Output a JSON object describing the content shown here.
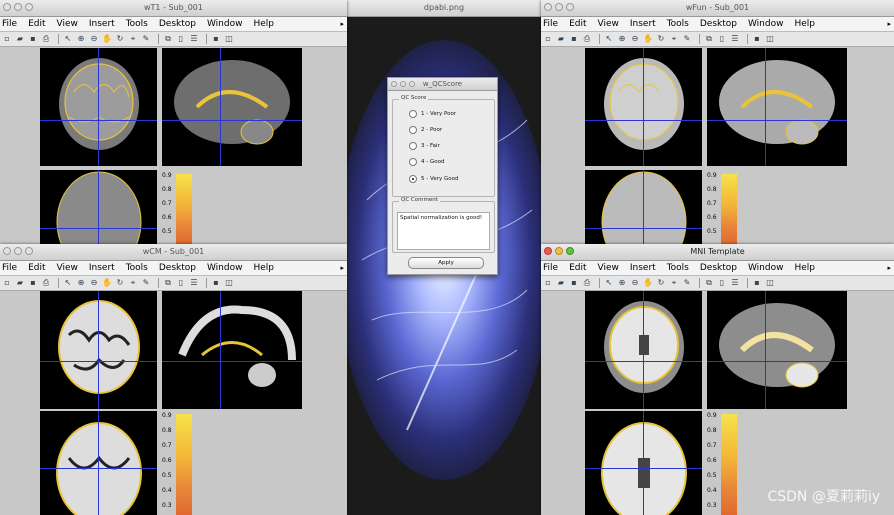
{
  "menu": [
    "File",
    "Edit",
    "View",
    "Insert",
    "Tools",
    "Desktop",
    "Window",
    "Help"
  ],
  "windows": {
    "wt1": {
      "title": "wT1 - Sub_001"
    },
    "wcm": {
      "title": "wCM - Sub_001"
    },
    "wfun": {
      "title": "wFun - Sub_001"
    },
    "mni": {
      "title": "MNI Template"
    }
  },
  "center_image": {
    "title": "dpabi.png"
  },
  "colorbar_ticks": [
    "0.9",
    "0.8",
    "0.7",
    "0.6",
    "0.5",
    "0.4",
    "0.3"
  ],
  "dialog": {
    "title": "w_QCScore",
    "score_group": "QC Score",
    "options": [
      "1 - Very Poor",
      "2 - Poor",
      "3 - Fair",
      "4 - Good",
      "5 - Very Good"
    ],
    "selected_option": "5 - Very Good",
    "comment_group": "QC Comment",
    "comment": "Spatial normalization is good!",
    "apply_label": "Apply"
  },
  "watermark": "CSDN @夏莉莉iy"
}
